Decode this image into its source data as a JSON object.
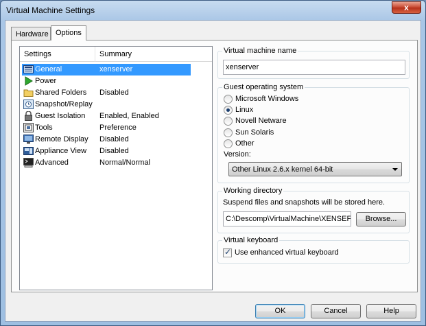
{
  "window": {
    "title": "Virtual Machine Settings",
    "close_glyph": "x"
  },
  "tabs": [
    {
      "label": "Hardware"
    },
    {
      "label": "Options"
    }
  ],
  "settings_list": {
    "headers": {
      "settings": "Settings",
      "summary": "Summary"
    },
    "rows": [
      {
        "name": "General",
        "summary": "xenserver",
        "icon": "general-icon"
      },
      {
        "name": "Power",
        "summary": "",
        "icon": "power-icon"
      },
      {
        "name": "Shared Folders",
        "summary": "Disabled",
        "icon": "folder-icon"
      },
      {
        "name": "Snapshot/Replay",
        "summary": "",
        "icon": "snapshot-icon"
      },
      {
        "name": "Guest Isolation",
        "summary": "Enabled, Enabled",
        "icon": "lock-icon"
      },
      {
        "name": "Tools",
        "summary": "Preference",
        "icon": "tools-icon"
      },
      {
        "name": "Remote Display",
        "summary": "Disabled",
        "icon": "monitor-icon"
      },
      {
        "name": "Appliance View",
        "summary": "Disabled",
        "icon": "appliance-icon"
      },
      {
        "name": "Advanced",
        "summary": "Normal/Normal",
        "icon": "terminal-icon"
      }
    ]
  },
  "vm_name": {
    "label": "Virtual machine name",
    "value": "xenserver"
  },
  "guest_os": {
    "label": "Guest operating system",
    "options": [
      "Microsoft Windows",
      "Linux",
      "Novell Netware",
      "Sun Solaris",
      "Other"
    ],
    "selected": "Linux",
    "version_label": "Version:",
    "version_value": "Other Linux 2.6.x kernel 64-bit"
  },
  "working_dir": {
    "label": "Working directory",
    "description": "Suspend files and snapshots will be stored here.",
    "path": "C:\\Descomp\\VirtualMachine\\XENSEF",
    "browse_label": "Browse..."
  },
  "virtual_keyboard": {
    "label": "Virtual keyboard",
    "checkbox_label": "Use enhanced virtual keyboard",
    "checked": true
  },
  "buttons": {
    "ok": "OK",
    "cancel": "Cancel",
    "help": "Help"
  }
}
